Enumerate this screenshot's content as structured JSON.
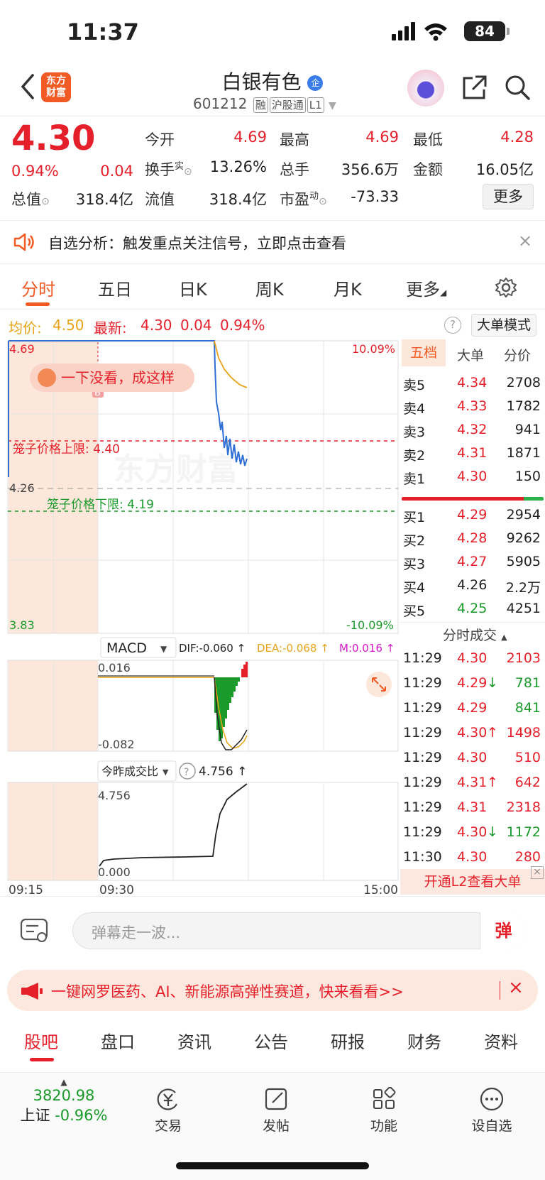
{
  "status": {
    "time": "11:37",
    "battery": "84"
  },
  "header": {
    "logo": [
      "东方",
      "财富"
    ],
    "name": "白银有色",
    "name_badge": "企",
    "code": "601212",
    "tags": [
      "融",
      "沪股通",
      "L1"
    ]
  },
  "quote": {
    "price": "4.30",
    "change_pct": "0.94%",
    "change": "0.04",
    "open_label": "今开",
    "open": "4.69",
    "high_label": "最高",
    "high": "4.69",
    "low_label": "最低",
    "low": "4.28",
    "turnover_label": "换手",
    "turnover_sup": "实",
    "turnover": "13.26%",
    "volume_label": "总手",
    "volume": "356.6万",
    "amount_label": "金额",
    "amount": "16.05亿",
    "mktcap_label": "总值",
    "mktcap": "318.4亿",
    "float_label": "流值",
    "float": "318.4亿",
    "pe_label": "市盈",
    "pe_sup": "动",
    "pe": "-73.33",
    "more": "更多"
  },
  "notice": {
    "text": "自选分析：触发重点关注信号，立即点击查看"
  },
  "chart_tabs": [
    "分时",
    "五日",
    "日K",
    "周K",
    "月K",
    "更多"
  ],
  "chart_info": {
    "avg_label": "均价:",
    "avg": "4.50",
    "last_label": "最新:",
    "last": "4.30",
    "chg": "0.04",
    "chg_pct": "0.94%",
    "mode": "大单模式"
  },
  "chart": {
    "y_top": "4.69",
    "y_mid": "4.26",
    "y_bot": "3.83",
    "pct_top": "10.09%",
    "pct_bot": "-10.09%",
    "upper_limit": "笼子价格上限: 4.40",
    "lower_limit": "笼子价格下限: 4.19",
    "bubble": "一下没看，成这样",
    "b_marker": "B",
    "watermark": "东方财富",
    "macd_label": "MACD",
    "dif": "DIF:-0.060 ↑",
    "dea": "DEA:-0.068 ↑",
    "m": "M:0.016 ↑",
    "macd_top": "0.016",
    "macd_bot": "-0.082",
    "ratio_label": "今昨成交比",
    "ratio_val": "4.756 ↑",
    "ratio_top": "4.756",
    "ratio_bot": "0.000",
    "time_start": "09:15",
    "time_open": "09:30",
    "time_end": "15:00"
  },
  "book": {
    "tabs": [
      "五档",
      "大单",
      "分价"
    ],
    "asks": [
      {
        "label": "卖5",
        "price": "4.34",
        "vol": "2708"
      },
      {
        "label": "卖4",
        "price": "4.33",
        "vol": "1782"
      },
      {
        "label": "卖3",
        "price": "4.32",
        "vol": "941"
      },
      {
        "label": "卖2",
        "price": "4.31",
        "vol": "1871"
      },
      {
        "label": "卖1",
        "price": "4.30",
        "vol": "150"
      }
    ],
    "bids": [
      {
        "label": "买1",
        "price": "4.29",
        "vol": "2954"
      },
      {
        "label": "买2",
        "price": "4.28",
        "vol": "9262"
      },
      {
        "label": "买3",
        "price": "4.27",
        "vol": "5905"
      },
      {
        "label": "买4",
        "price": "4.26",
        "vol": "2.2万"
      },
      {
        "label": "买5",
        "price": "4.25",
        "vol": "4251"
      }
    ],
    "trades_title": "分时成交",
    "trades": [
      {
        "time": "11:29",
        "price": "4.30",
        "vol": "2103",
        "dir": ""
      },
      {
        "time": "11:29",
        "price": "4.29",
        "vol": "781",
        "dir": "↓"
      },
      {
        "time": "11:29",
        "price": "4.29",
        "vol": "841",
        "dir": ""
      },
      {
        "time": "11:29",
        "price": "4.30",
        "vol": "1498",
        "dir": "↑"
      },
      {
        "time": "11:29",
        "price": "4.30",
        "vol": "510",
        "dir": ""
      },
      {
        "time": "11:29",
        "price": "4.31",
        "vol": "642",
        "dir": "↑"
      },
      {
        "time": "11:29",
        "price": "4.31",
        "vol": "2318",
        "dir": ""
      },
      {
        "time": "11:29",
        "price": "4.30",
        "vol": "1172",
        "dir": "↓"
      },
      {
        "time": "11:30",
        "price": "4.30",
        "vol": "280",
        "dir": ""
      }
    ],
    "l2": "开通L2查看大单"
  },
  "danmu": {
    "placeholder": "弹幕走一波...",
    "btn": "弹"
  },
  "promo": {
    "text": "一键网罗医药、AI、新能源高弹性赛道，快来看看>>"
  },
  "bottom_tabs": [
    "股吧",
    "盘口",
    "资讯",
    "公告",
    "研报",
    "财务",
    "资料"
  ],
  "nav": {
    "index_value": "3820.98",
    "index_name": "上证",
    "index_change": "-0.96%",
    "items": [
      "交易",
      "发帖",
      "功能",
      "设自选"
    ]
  },
  "colors": {
    "up": "#e5202a",
    "down": "#1a9a2a",
    "accent": "#f15a24"
  }
}
